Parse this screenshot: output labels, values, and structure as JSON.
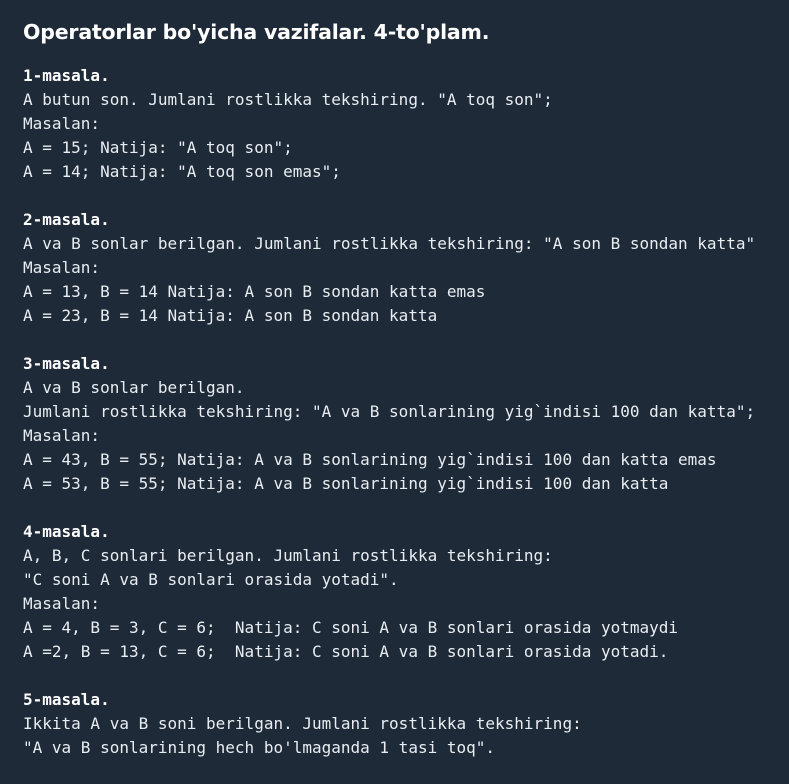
{
  "title": "Operatorlar bo'yicha vazifalar. 4-to'plam.",
  "problems": [
    {
      "heading": "1-masala.",
      "lines": [
        "A butun son. Jumlani rostlikka tekshiring. \"A toq son\";",
        "Masalan:",
        "A = 15; Natija: \"A toq son\";",
        "A = 14; Natija: \"A toq son emas\";"
      ]
    },
    {
      "heading": "2-masala.",
      "lines": [
        "A va B sonlar berilgan. Jumlani rostlikka tekshiring: \"A son B sondan katta\"",
        "Masalan:",
        "A = 13, B = 14 Natija: A son B sondan katta emas",
        "A = 23, B = 14 Natija: A son B sondan katta"
      ]
    },
    {
      "heading": "3-masala.",
      "lines": [
        "A va B sonlar berilgan.",
        "Jumlani rostlikka tekshiring: \"A va B sonlarining yig`indisi 100 dan katta\";",
        "Masalan:",
        "A = 43, B = 55; Natija: A va B sonlarining yig`indisi 100 dan katta emas",
        "A = 53, B = 55; Natija: A va B sonlarining yig`indisi 100 dan katta"
      ]
    },
    {
      "heading": "4-masala.",
      "lines": [
        "A, B, C sonlari berilgan. Jumlani rostlikka tekshiring:",
        "\"C soni A va B sonlari orasida yotadi\".",
        "Masalan:",
        "A = 4, B = 3, C = 6;  Natija: C soni A va B sonlari orasida yotmaydi",
        "A =2, B = 13, C = 6;  Natija: C soni A va B sonlari orasida yotadi."
      ]
    },
    {
      "heading": "5-masala.",
      "lines": [
        "Ikkita A va B soni berilgan. Jumlani rostlikka tekshiring:",
        "\"A va B sonlarining hech bo'lmaganda 1 tasi toq\"."
      ]
    }
  ]
}
